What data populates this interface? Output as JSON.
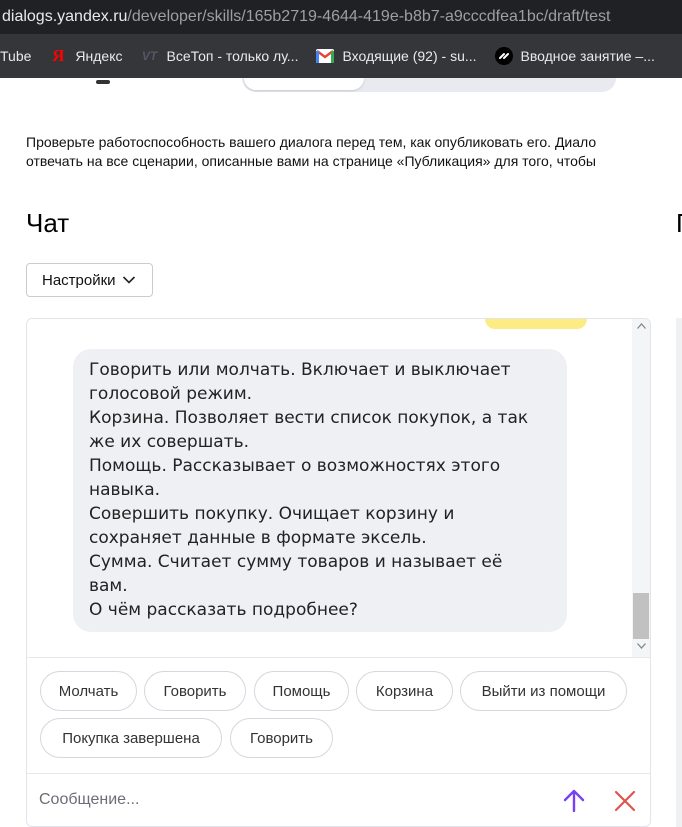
{
  "browser": {
    "url_host": "dialogs.yandex.ru",
    "url_path": "/developer/skills/165b2719-4644-419e-b8b7-a9cccdfea1bc/draft/test",
    "bookmarks": [
      {
        "label": "Tube",
        "icon": "youtube-icon"
      },
      {
        "label": "Яндекс",
        "icon": "yandex-icon"
      },
      {
        "label": "ВсеТоп - только лу...",
        "icon": "vsetop-icon"
      },
      {
        "label": "Входящие (92) - su...",
        "icon": "gmail-icon"
      },
      {
        "label": "Вводное занятие –...",
        "icon": "skillbox-icon"
      }
    ]
  },
  "page": {
    "description_line1": "Проверьте работоспособность вашего диалога перед тем, как опубликовать его. Диало",
    "description_line2": "отвечать на все сценарии, описанные вами на странице «Публикация» для того, чтобы",
    "chat_title": "Чат",
    "side_title": "П",
    "settings_label": "Настройки"
  },
  "chat": {
    "bot_message_lines": [
      "Говорить или молчать. Включает и выключает",
      "голосовой режим.",
      "Корзина. Позволяет вести список покупок, а так",
      "же их совершать.",
      "Помощь. Рассказывает о возможностях этого",
      "навыка.",
      "Совершить покупку. Очищает корзину и",
      "сохраняет данные в формате эксель.",
      "Сумма. Считает сумму товаров и называет её",
      "вам.",
      "О чём рассказать подробнее?"
    ],
    "suggests": [
      "Молчать",
      "Говорить",
      "Помощь",
      "Корзина",
      "Выйти из помощи",
      "Покупка завершена",
      "Говорить"
    ],
    "input_placeholder": "Сообщение...",
    "send_icon": "arrow-up-icon",
    "clear_icon": "close-icon"
  },
  "colors": {
    "accent": "#7b3ff2",
    "clear": "#e0534e",
    "user_bubble": "#fdeb84",
    "bot_bubble": "#eef0f4"
  }
}
